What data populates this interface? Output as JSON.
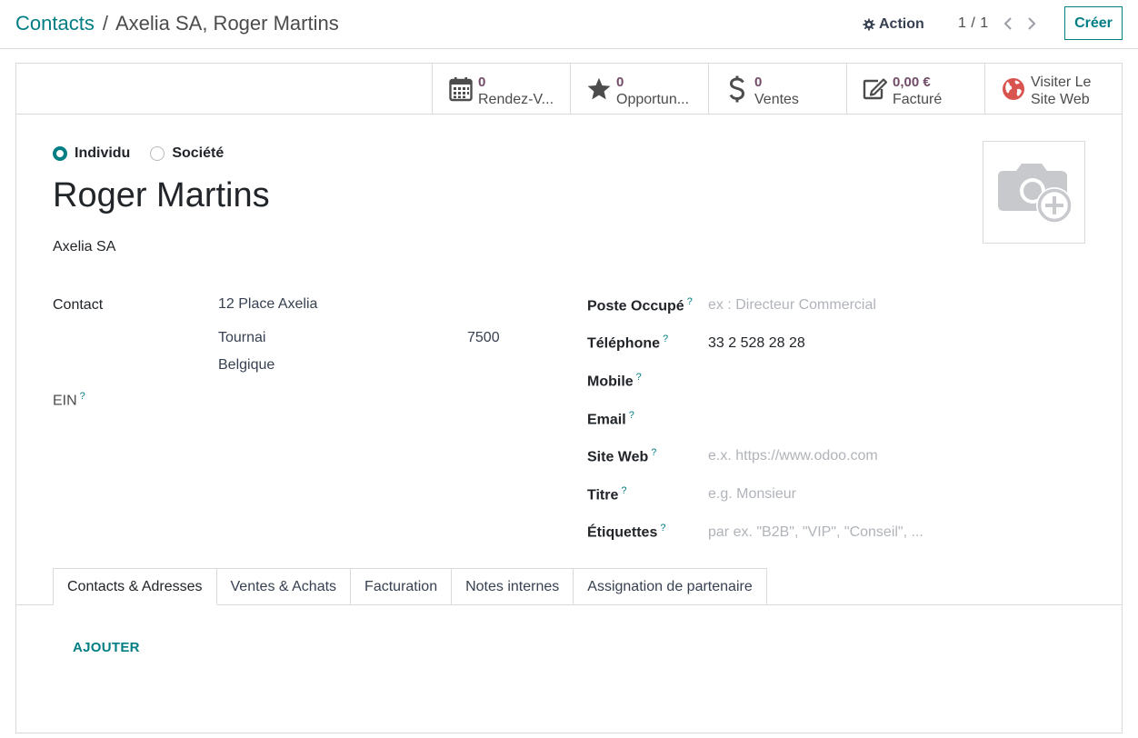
{
  "breadcrumb": {
    "root": "Contacts",
    "separator": "/",
    "current": "Axelia SA, Roger Martins"
  },
  "toolbar": {
    "action_label": "Action",
    "pager_text": "1 / 1",
    "create_label": "Créer"
  },
  "stat_buttons": [
    {
      "icon": "calendar-icon",
      "value": "0",
      "label": "Rendez-V..."
    },
    {
      "icon": "star-icon",
      "value": "0",
      "label": "Opportun..."
    },
    {
      "icon": "dollar-icon",
      "value": "0",
      "label": "Ventes"
    },
    {
      "icon": "invoice-edit-icon",
      "value": "0,00 €",
      "label": "Facturé"
    },
    {
      "icon": "globe-icon",
      "value": "Visiter Le",
      "label": "Site Web"
    }
  ],
  "company_type": {
    "options": [
      "Individu",
      "Société"
    ],
    "selected": "Individu"
  },
  "contact": {
    "name": "Roger Martins",
    "company": "Axelia SA",
    "address_label": "Contact",
    "street": "12 Place Axelia",
    "city": "Tournai",
    "zip": "7500",
    "country": "Belgique",
    "ein_label": "EIN"
  },
  "fields": {
    "job": {
      "label": "Poste Occupé",
      "placeholder": "ex : Directeur Commercial"
    },
    "phone": {
      "label": "Téléphone",
      "value": "33 2 528 28 28"
    },
    "mobile": {
      "label": "Mobile"
    },
    "email": {
      "label": "Email"
    },
    "website": {
      "label": "Site Web",
      "placeholder": "e.x. https://www.odoo.com"
    },
    "title": {
      "label": "Titre",
      "placeholder": "e.g. Monsieur"
    },
    "tags": {
      "label": "Étiquettes",
      "placeholder": "par ex. \"B2B\", \"VIP\", \"Conseil\", ..."
    }
  },
  "help_marker": "?",
  "tabs": [
    "Contacts & Adresses",
    "Ventes & Achats",
    "Facturation",
    "Notes internes",
    "Assignation de partenaire"
  ],
  "active_tab": "Contacts & Adresses",
  "add_label": "AJOUTER",
  "colors": {
    "accent": "#017e84",
    "brand": "#714b67",
    "border": "#d8dadd",
    "placeholder": "#b0b4ba"
  }
}
